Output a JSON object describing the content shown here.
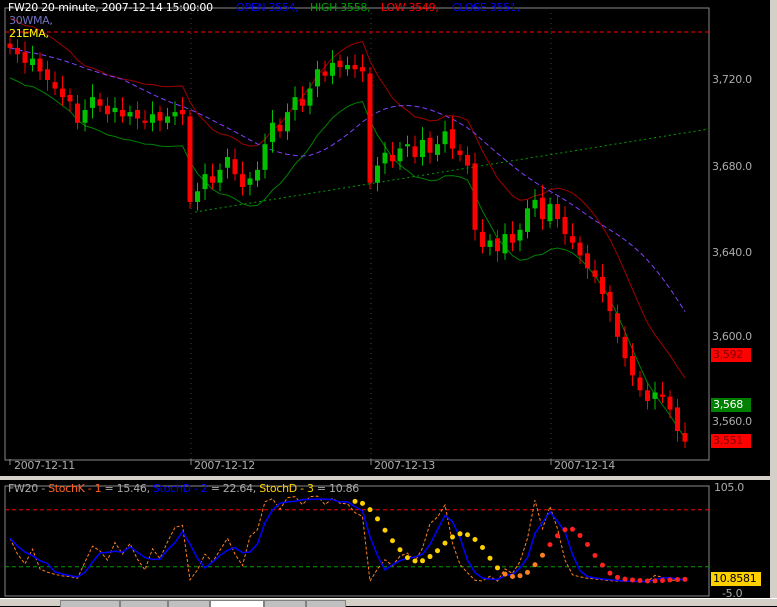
{
  "header": {
    "symbol_line": "FW20 20-minute, 2007-12-14 15:00:00",
    "open": "OPEN 3554,",
    "high": "HIGH 3558,",
    "low": "LOW 3549,",
    "close": "CLOSE 3551,",
    "wma": "30WMA,",
    "ema": "21EMA,"
  },
  "price_axis": [
    "3,720.0",
    "3,680.0",
    "3,640.0",
    "3,600.0",
    "3,560.0"
  ],
  "badges": {
    "upper": "3,592",
    "middle": "3,568",
    "last": "3,551"
  },
  "date_axis": [
    "2007-12-11",
    "2007-12-12",
    "2007-12-13",
    "2007-12-14"
  ],
  "stoch": {
    "title": "FW20 - ",
    "k": "StochK - 1",
    "k_val": " = 15.46, ",
    "d2": "StochD - 2",
    "d2_val": " = 22.64, ",
    "d3": "StochD - 3",
    "d3_val": " = 10.86",
    "axis_top": "105.0",
    "axis_bottom": "-5.0",
    "badge": "10.8581"
  },
  "colors": {
    "up": "#00c000",
    "down": "#ff0000",
    "wma": "#8040ff",
    "upper_band": "#a00000",
    "lower_band": "#008000",
    "stochK": "#ff8020",
    "stochD2": "#0000ff",
    "stochD3": "#ffd000"
  },
  "chart_data": {
    "type": "candlestick",
    "closes": [
      3735,
      3732,
      3728,
      3730,
      3724,
      3720,
      3716,
      3712,
      3710,
      3700,
      3706,
      3712,
      3708,
      3704,
      3707,
      3703,
      3705,
      3702,
      3700,
      3704,
      3701,
      3703,
      3705,
      3704,
      3663,
      3668,
      3676,
      3672,
      3678,
      3684,
      3676,
      3670,
      3674,
      3678,
      3690,
      3700,
      3696,
      3705,
      3712,
      3708,
      3716,
      3725,
      3722,
      3728,
      3726,
      3727,
      3725,
      3724,
      3672,
      3680,
      3686,
      3682,
      3688,
      3690,
      3684,
      3692,
      3686,
      3690,
      3696,
      3688,
      3685,
      3680,
      3650,
      3642,
      3645,
      3640,
      3648,
      3644,
      3650,
      3660,
      3664,
      3655,
      3662,
      3655,
      3648,
      3644,
      3638,
      3632,
      3628,
      3620,
      3612,
      3600,
      3590,
      3582,
      3575,
      3570,
      3574,
      3572,
      3566,
      3556,
      3551
    ],
    "ylim": [
      3540,
      3750
    ],
    "stoch_ylim": [
      -5,
      105
    ]
  }
}
